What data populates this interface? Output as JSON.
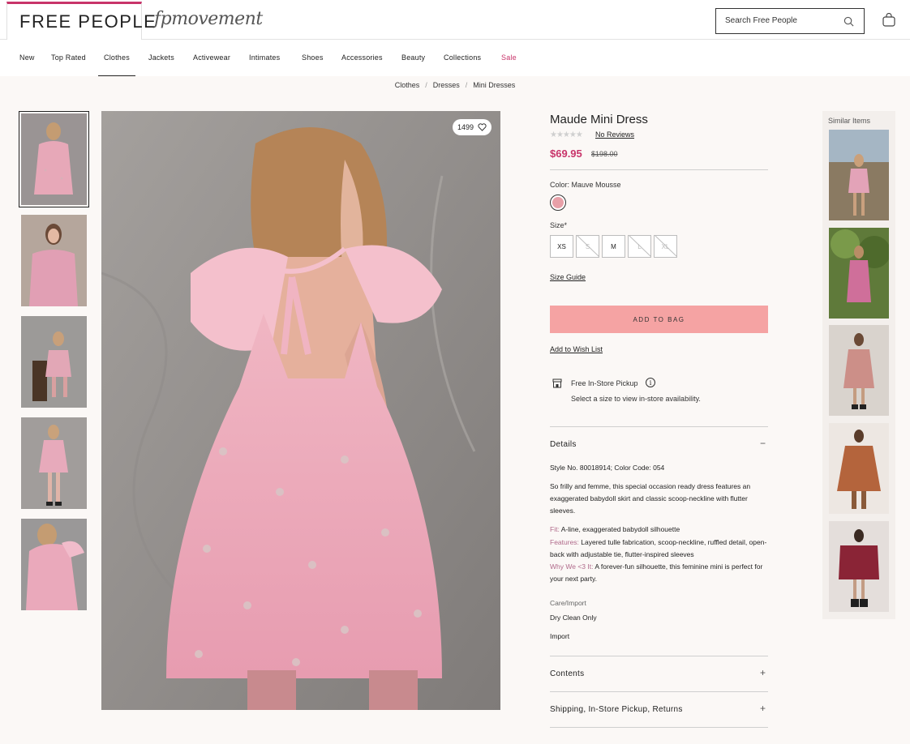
{
  "header": {
    "logo": "FREE PEOPLE",
    "sub_brand": "fpmovement",
    "search_placeholder": "Search Free People",
    "bag_icon": "shopping-bag-icon"
  },
  "nav": {
    "items": [
      "New",
      "Top Rated",
      "Clothes",
      "Jackets",
      "Activewear",
      "Intimates",
      "Shoes",
      "Accessories",
      "Beauty",
      "Collections",
      "Sale"
    ],
    "active": "Clothes",
    "sale_color": "#c8346a"
  },
  "breadcrumb": [
    "Clothes",
    "Dresses",
    "Mini Dresses"
  ],
  "gallery": {
    "favorites_count": "1499",
    "thumbnail_count": 5,
    "selected_index": 0
  },
  "product": {
    "title": "Maude Mini Dress",
    "reviews_link": "No Reviews",
    "stars": "★★★★★",
    "price": "$69.95",
    "original_price": "$198.00",
    "color_label": "Color: Mauve Mousse",
    "swatch_color": "#e8a0a8",
    "size_label": "Size*",
    "sizes": [
      {
        "label": "XS",
        "available": true
      },
      {
        "label": "S",
        "available": false
      },
      {
        "label": "M",
        "available": true
      },
      {
        "label": "L",
        "available": false
      },
      {
        "label": "XL",
        "available": false
      }
    ],
    "size_guide": "Size Guide",
    "add_to_bag": "ADD TO BAG",
    "wishlist": "Add to Wish List",
    "pickup_title": "Free In-Store Pickup",
    "pickup_sub": "Select a size to view in-store availability.",
    "accent_color": "#f5a3a3"
  },
  "details": {
    "title": "Details",
    "style_line": "Style No. 80018914; Color Code: 054",
    "description": "So frilly and femme, this special occasion ready dress features an exaggerated babydoll skirt and classic scoop-neckline with flutter sleeves.",
    "fit_label": "Fit:",
    "fit": "A-line, exaggerated babydoll silhouette",
    "features_label": "Features:",
    "features": "Layered tulle fabrication, scoop-neckline, ruffled detail, open-back with adjustable tie, flutter-inspired sleeves",
    "why_label": "Why We <3 It:",
    "why": "A forever-fun silhouette, this feminine mini is perfect for your next party.",
    "care_title": "Care/Import",
    "care": "Dry Clean Only",
    "import": "Import"
  },
  "accordions": {
    "contents": "Contents",
    "shipping": "Shipping, In-Store Pickup, Returns"
  },
  "similar": {
    "title": "Similar Items"
  }
}
